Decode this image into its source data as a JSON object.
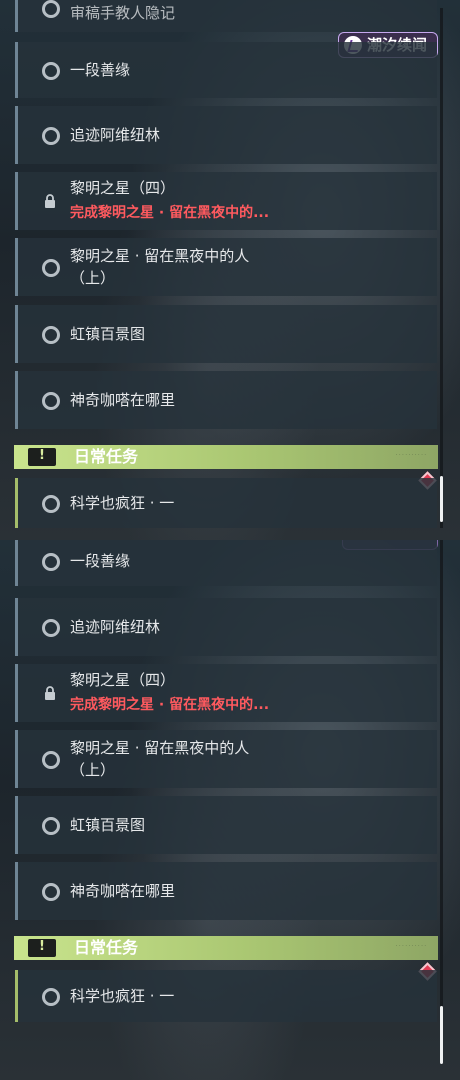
{
  "panel1": {
    "partial_top_title": "审稿手教人隐记",
    "badge_label": "潮汐续闻",
    "quests": [
      {
        "title": "一段善缘"
      },
      {
        "title": "追迹阿维纽林"
      },
      {
        "title": "黎明之星（四）",
        "subtitle": "完成黎明之星 · 留在黑夜中的..."
      },
      {
        "title": "黎明之星 · 留在黑夜中的人",
        "title2": "（上）"
      },
      {
        "title": "虹镇百景图"
      },
      {
        "title": "神奇咖嗒在哪里"
      }
    ],
    "daily_header": "日常任务",
    "daily_quests": [
      {
        "title": "科学也疯狂 · 一"
      }
    ]
  },
  "panel2": {
    "quests": [
      {
        "title": "一段善缘"
      },
      {
        "title": "追迹阿维纽林"
      },
      {
        "title": "黎明之星（四）",
        "subtitle": "完成黎明之星 · 留在黑夜中的..."
      },
      {
        "title": "黎明之星 · 留在黑夜中的人",
        "title2": "（上）"
      },
      {
        "title": "虹镇百景图"
      },
      {
        "title": "神奇咖嗒在哪里"
      }
    ],
    "daily_header": "日常任务",
    "daily_quests": [
      {
        "title": "科学也疯狂 · 一"
      }
    ]
  },
  "icons": {
    "incomplete": "circle-icon",
    "locked": "lock-icon",
    "daily": "exclamation-icon",
    "tracked": "diamond-marker-icon"
  },
  "colors": {
    "daily_accent": "#a5bd6a",
    "warning_text": "#ff5a5f",
    "badge_border": "#c6a8ee"
  }
}
